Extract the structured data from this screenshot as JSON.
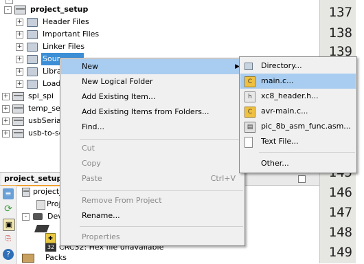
{
  "projects_tree": {
    "project_name": "project_setup",
    "children": [
      {
        "label": "Header Files"
      },
      {
        "label": "Important Files"
      },
      {
        "label": "Linker Files"
      },
      {
        "label": "Sour"
      },
      {
        "label": "Libra"
      },
      {
        "label": "Load"
      }
    ],
    "other_projects": [
      {
        "label": "spi_spi"
      },
      {
        "label": "temp_se"
      },
      {
        "label": "usbSerial"
      },
      {
        "label": "usb-to-se"
      }
    ]
  },
  "editor": {
    "line_numbers": [
      "137",
      "138",
      "139",
      "145",
      "146",
      "147",
      "148",
      "149"
    ]
  },
  "dashboard": {
    "tab_title": "project_setup",
    "tree": [
      {
        "label": "project_"
      },
      {
        "label": "Proj"
      },
      {
        "label": "Dev"
      },
      {
        "label": "CRC32: Hex file unavailable"
      },
      {
        "label": "Packs"
      }
    ]
  },
  "context_menu": {
    "items": [
      {
        "label": "New",
        "shortcut": "",
        "enabled": true,
        "submenu": true
      },
      {
        "label": "New Logical Folder",
        "shortcut": "",
        "enabled": true
      },
      {
        "label": "Add Existing Item...",
        "shortcut": "",
        "enabled": true
      },
      {
        "label": "Add Existing Items from Folders...",
        "shortcut": "",
        "enabled": true
      },
      {
        "label": "Find...",
        "shortcut": "",
        "enabled": true
      },
      {
        "label": "Cut",
        "shortcut": "",
        "enabled": false
      },
      {
        "label": "Copy",
        "shortcut": "",
        "enabled": false
      },
      {
        "label": "Paste",
        "shortcut": "Ctrl+V",
        "enabled": false
      },
      {
        "label": "Remove From Project",
        "shortcut": "",
        "enabled": false
      },
      {
        "label": "Rename...",
        "shortcut": "",
        "enabled": true
      },
      {
        "label": "Properties",
        "shortcut": "",
        "enabled": false
      }
    ]
  },
  "new_submenu": {
    "items": [
      {
        "label": "Directory..."
      },
      {
        "label": "main.c..."
      },
      {
        "label": "xc8_header.h..."
      },
      {
        "label": "avr-main.c..."
      },
      {
        "label": "pic_8b_asm_func.asm..."
      },
      {
        "label": "Text File..."
      },
      {
        "label": "Other..."
      }
    ]
  },
  "colors": {
    "menu_highlight": "#a9cdf0",
    "selection": "#3c8fd6",
    "tab_accent": "#f0a030"
  }
}
